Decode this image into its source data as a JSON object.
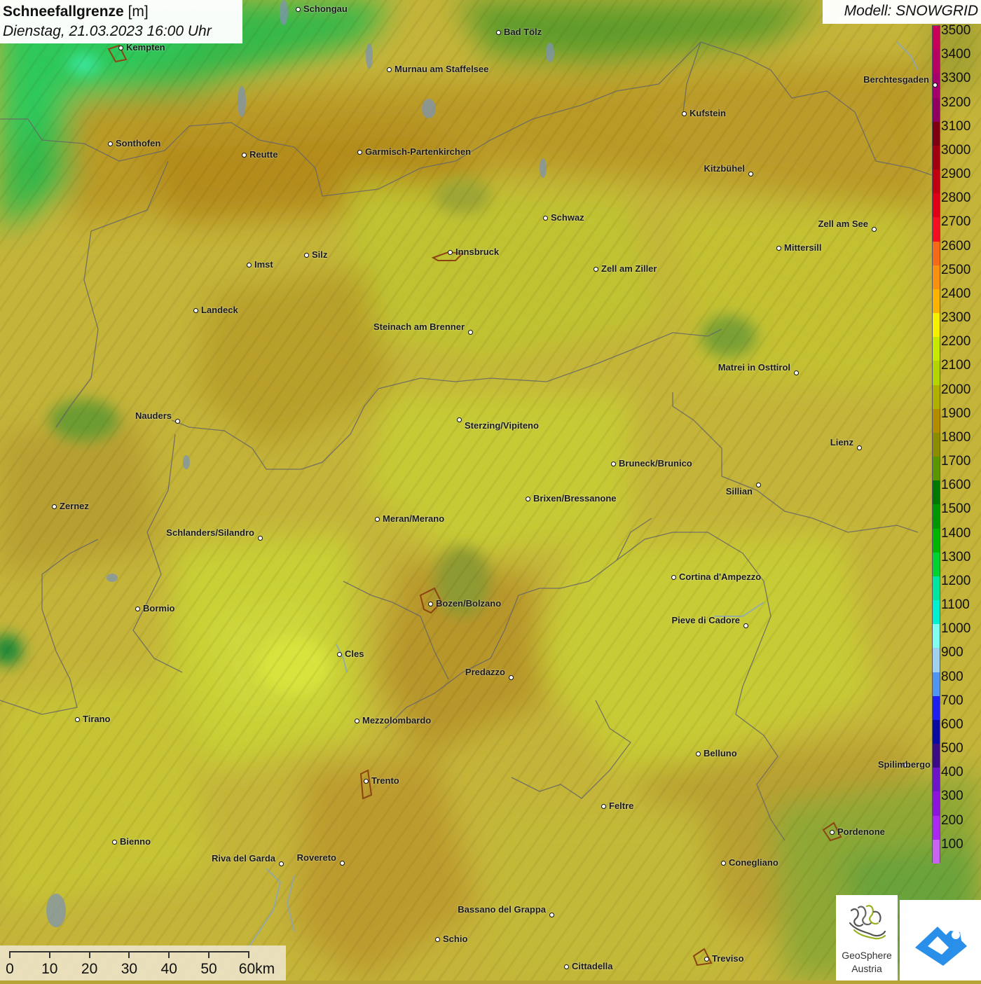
{
  "header": {
    "title_bold": "Schneefallgrenze",
    "title_unit": "[m]",
    "date_line": "Dienstag, 21.03.2023 16:00 Uhr"
  },
  "model_label": "Modell: SNOWGRID",
  "legend": {
    "levels": [
      {
        "label": "3500",
        "color": "#c7005a"
      },
      {
        "label": "3400",
        "color": "#b50064"
      },
      {
        "label": "3300",
        "color": "#a5006c"
      },
      {
        "label": "3200",
        "color": "#900060"
      },
      {
        "label": "3100",
        "color": "#7d0010"
      },
      {
        "label": "3000",
        "color": "#a00010"
      },
      {
        "label": "2900",
        "color": "#c00010"
      },
      {
        "label": "2800",
        "color": "#dd0016"
      },
      {
        "label": "2700",
        "color": "#f21020"
      },
      {
        "label": "2600",
        "color": "#f56a18"
      },
      {
        "label": "2500",
        "color": "#f89010"
      },
      {
        "label": "2400",
        "color": "#fab400"
      },
      {
        "label": "2300",
        "color": "#f4f000"
      },
      {
        "label": "2200",
        "color": "#c8e800"
      },
      {
        "label": "2100",
        "color": "#b4d400"
      },
      {
        "label": "2000",
        "color": "#b0b000"
      },
      {
        "label": "1900",
        "color": "#b48c00"
      },
      {
        "label": "1800",
        "color": "#8c8c00"
      },
      {
        "label": "1700",
        "color": "#5a9600"
      },
      {
        "label": "1600",
        "color": "#007800"
      },
      {
        "label": "1500",
        "color": "#009600"
      },
      {
        "label": "1400",
        "color": "#00b400"
      },
      {
        "label": "1300",
        "color": "#00d232"
      },
      {
        "label": "1200",
        "color": "#00e6a0"
      },
      {
        "label": "1100",
        "color": "#00f0d2"
      },
      {
        "label": "1000",
        "color": "#80fff0"
      },
      {
        "label": "900",
        "color": "#a0d2f0"
      },
      {
        "label": "800",
        "color": "#5096f0"
      },
      {
        "label": "700",
        "color": "#1e1ef0"
      },
      {
        "label": "600",
        "color": "#0a0aa0"
      },
      {
        "label": "500",
        "color": "#3c0a82"
      },
      {
        "label": "400",
        "color": "#6e14c8"
      },
      {
        "label": "300",
        "color": "#8c14dc"
      },
      {
        "label": "200",
        "color": "#aa28f0"
      },
      {
        "label": "100",
        "color": "#c864f0"
      }
    ]
  },
  "cities": [
    {
      "name": "Schongau"
    },
    {
      "name": "Bad Tölz"
    },
    {
      "name": "Kempten"
    },
    {
      "name": "Murnau am Staffelsee"
    },
    {
      "name": "Berchtesgaden"
    },
    {
      "name": "Kufstein"
    },
    {
      "name": "Sonthofen"
    },
    {
      "name": "Reutte"
    },
    {
      "name": "Garmisch-Partenkirchen"
    },
    {
      "name": "Kitzbühel"
    },
    {
      "name": "Schwaz"
    },
    {
      "name": "Zell am See"
    },
    {
      "name": "Innsbruck"
    },
    {
      "name": "Mittersill"
    },
    {
      "name": "Silz"
    },
    {
      "name": "Imst"
    },
    {
      "name": "Zell am Ziller"
    },
    {
      "name": "Landeck"
    },
    {
      "name": "Steinach am Brenner"
    },
    {
      "name": "Matrei in Osttirol"
    },
    {
      "name": "Nauders"
    },
    {
      "name": "Sterzing/Vipiteno"
    },
    {
      "name": "Lienz"
    },
    {
      "name": "Bruneck/Brunico"
    },
    {
      "name": "Sillian"
    },
    {
      "name": "Brixen/Bressanone"
    },
    {
      "name": "Zernez"
    },
    {
      "name": "Meran/Merano"
    },
    {
      "name": "Schlanders/Silandro"
    },
    {
      "name": "Cortina d'Ampezzo"
    },
    {
      "name": "Bozen/Bolzano"
    },
    {
      "name": "Bormio"
    },
    {
      "name": "Pieve di Cadore"
    },
    {
      "name": "Cles"
    },
    {
      "name": "Predazzo"
    },
    {
      "name": "Tirano"
    },
    {
      "name": "Mezzolombardo"
    },
    {
      "name": "Belluno"
    },
    {
      "name": "Spilimbergo"
    },
    {
      "name": "Trento"
    },
    {
      "name": "Feltre"
    },
    {
      "name": "Pordenone"
    },
    {
      "name": "Bienno"
    },
    {
      "name": "Riva del Garda"
    },
    {
      "name": "Rovereto"
    },
    {
      "name": "Conegliano"
    },
    {
      "name": "Bassano del Grappa"
    },
    {
      "name": "Schio"
    },
    {
      "name": "Treviso"
    },
    {
      "name": "Cittadella"
    }
  ],
  "scale": {
    "labels": [
      "0",
      "10",
      "20",
      "30",
      "40",
      "50",
      "60km"
    ]
  },
  "logos": {
    "geosphere_line1": "GeoSphere",
    "geosphere_line2": "Austria"
  }
}
